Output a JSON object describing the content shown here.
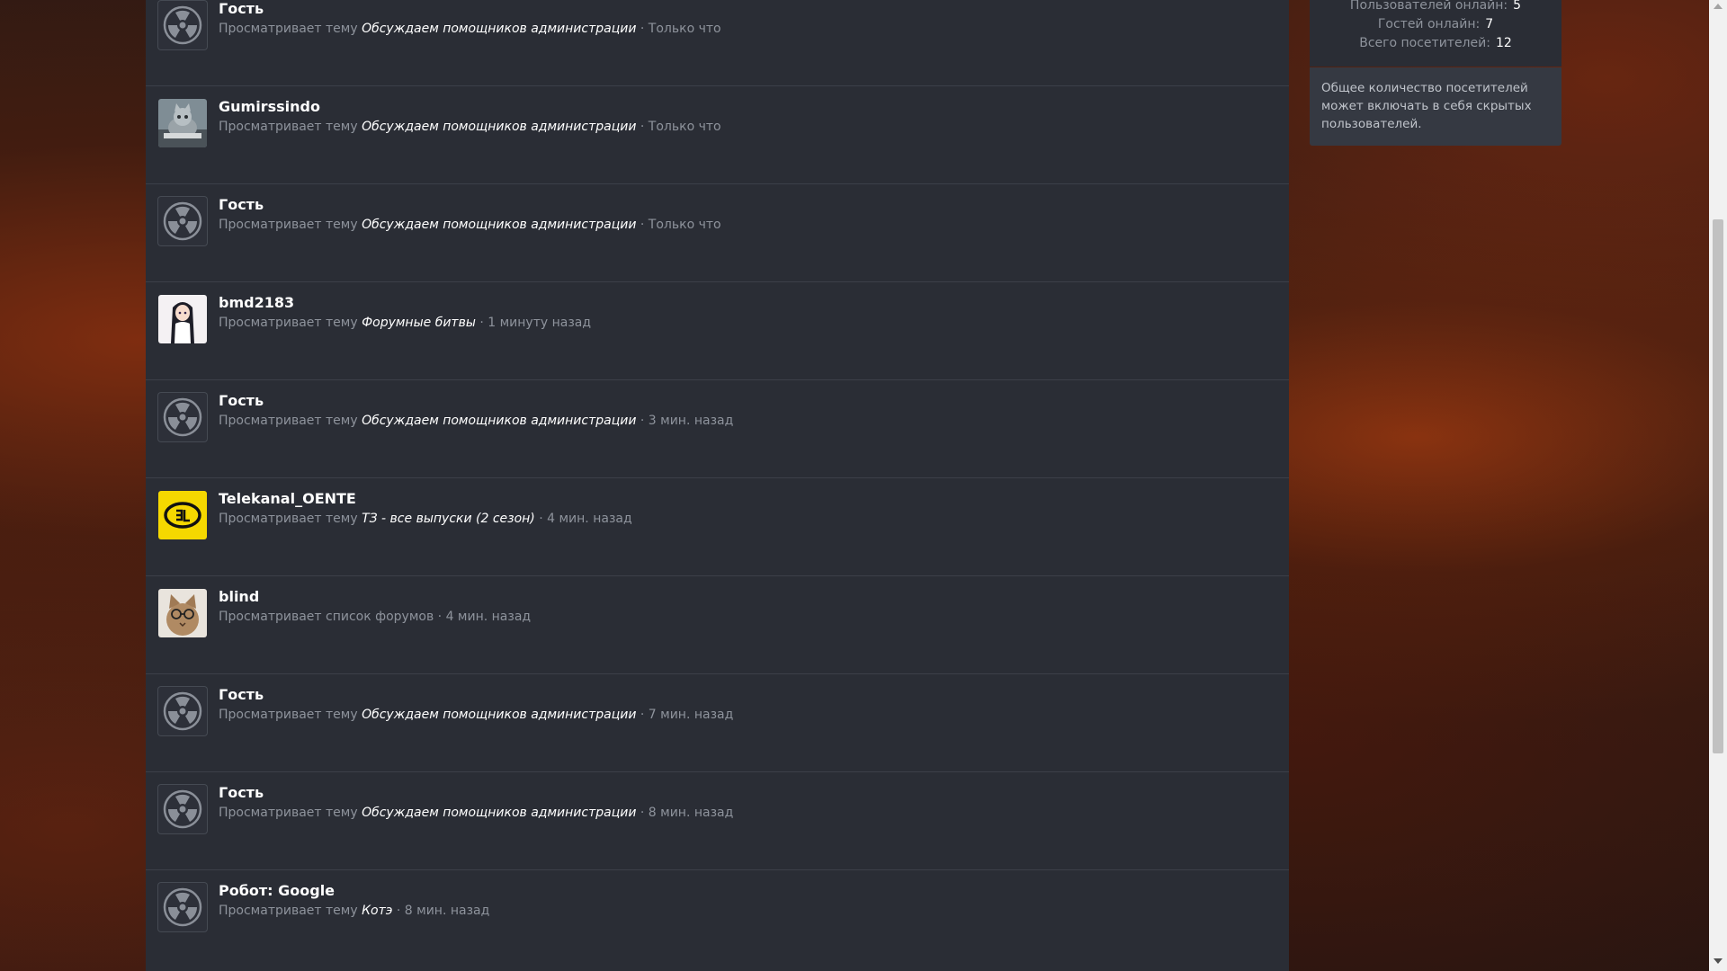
{
  "online_list": {
    "prefix": "Просматривает тему",
    "rows": [
      {
        "user": "Гость",
        "avatar": "radiation-icon",
        "action": "Просматривает тему",
        "topic": "Обсуждаем помощников администрации",
        "time": "· Только что"
      },
      {
        "user": "Gumirssindo",
        "avatar": "cat-photo",
        "action": "Просматривает тему",
        "topic": "Обсуждаем помощников администрации",
        "time": "· Только что"
      },
      {
        "user": "Гость",
        "avatar": "radiation-icon",
        "action": "Просматривает тему",
        "topic": "Обсуждаем помощников администрации",
        "time": "· Только что"
      },
      {
        "user": "bmd2183",
        "avatar": "anime-girl",
        "action": "Просматривает тему",
        "topic": "Форумные битвы",
        "time": "· 1 минуту назад"
      },
      {
        "user": "Гость",
        "avatar": "radiation-icon",
        "action": "Просматривает тему",
        "topic": "Обсуждаем помощников администрации",
        "time": "· 3 мин. назад"
      },
      {
        "user": "Telekanal_OENTE",
        "avatar": "yellow-logo",
        "action": "Просматривает тему",
        "topic": "ТЗ - все выпуски (2 сезон)",
        "time": "· 4 мин. назад"
      },
      {
        "user": "blind",
        "avatar": "cat-glasses",
        "action": "Просматривает список форумов",
        "topic": "",
        "time": "· 4 мин. назад"
      },
      {
        "user": "Гость",
        "avatar": "radiation-icon",
        "action": "Просматривает тему",
        "topic": "Обсуждаем помощников администрации",
        "time": "· 7 мин. назад"
      },
      {
        "user": "Гость",
        "avatar": "radiation-icon",
        "action": "Просматривает тему",
        "topic": "Обсуждаем помощников администрации",
        "time": "· 8 мин. назад"
      },
      {
        "user": "Робот: Google",
        "avatar": "radiation-icon",
        "action": "Просматривает тему",
        "topic": "Котэ",
        "time": "· 8 мин. назад"
      }
    ]
  },
  "sidebar": {
    "members_label": "Пользователей онлайн:",
    "members_value": "5",
    "guests_label": "Гостей онлайн:",
    "guests_value": "7",
    "total_label": "Всего посетителей:",
    "total_value": "12",
    "note": "Общее количество посетителей может включать в себя скрытых пользователей."
  },
  "colors": {
    "panel": "#2a2d35",
    "muted_text": "#8e939c",
    "username": "#ffffff",
    "avatar_yellow": "#f5d800"
  }
}
